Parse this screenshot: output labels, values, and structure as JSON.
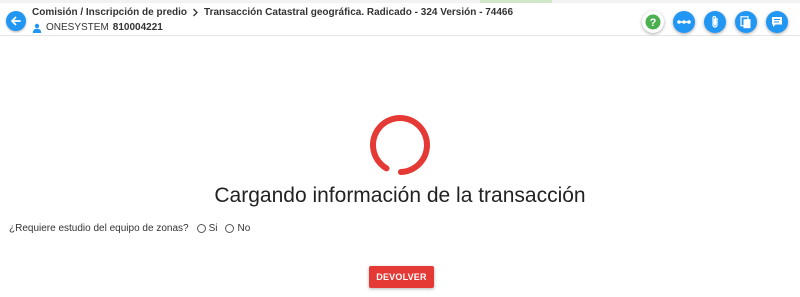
{
  "header": {
    "breadcrumb": {
      "parent": "Comisión / Inscripción de predio",
      "current": "Transacción Catastral geográfica. Radicado - 324 Versión - 74466"
    },
    "user": {
      "org_name": "ONESYSTEM",
      "org_id": "810004221"
    },
    "actions": [
      {
        "icon": "help-icon",
        "color": "#4caf50"
      },
      {
        "icon": "flow-icon",
        "color": "#2196f3"
      },
      {
        "icon": "attachment-icon",
        "color": "#2196f3"
      },
      {
        "icon": "documents-icon",
        "color": "#2196f3"
      },
      {
        "icon": "notes-icon",
        "color": "#2196f3"
      }
    ]
  },
  "main": {
    "loading_text": "Cargando información de la transacción",
    "question": {
      "label": "¿Requiere estudio del equipo de zonas?",
      "options": [
        "Si",
        "No"
      ]
    },
    "return_button": "DEVOLVER"
  },
  "colors": {
    "accent": "#2196f3",
    "spinner": "#e53935",
    "danger_button": "#e53935",
    "help": "#4caf50"
  }
}
